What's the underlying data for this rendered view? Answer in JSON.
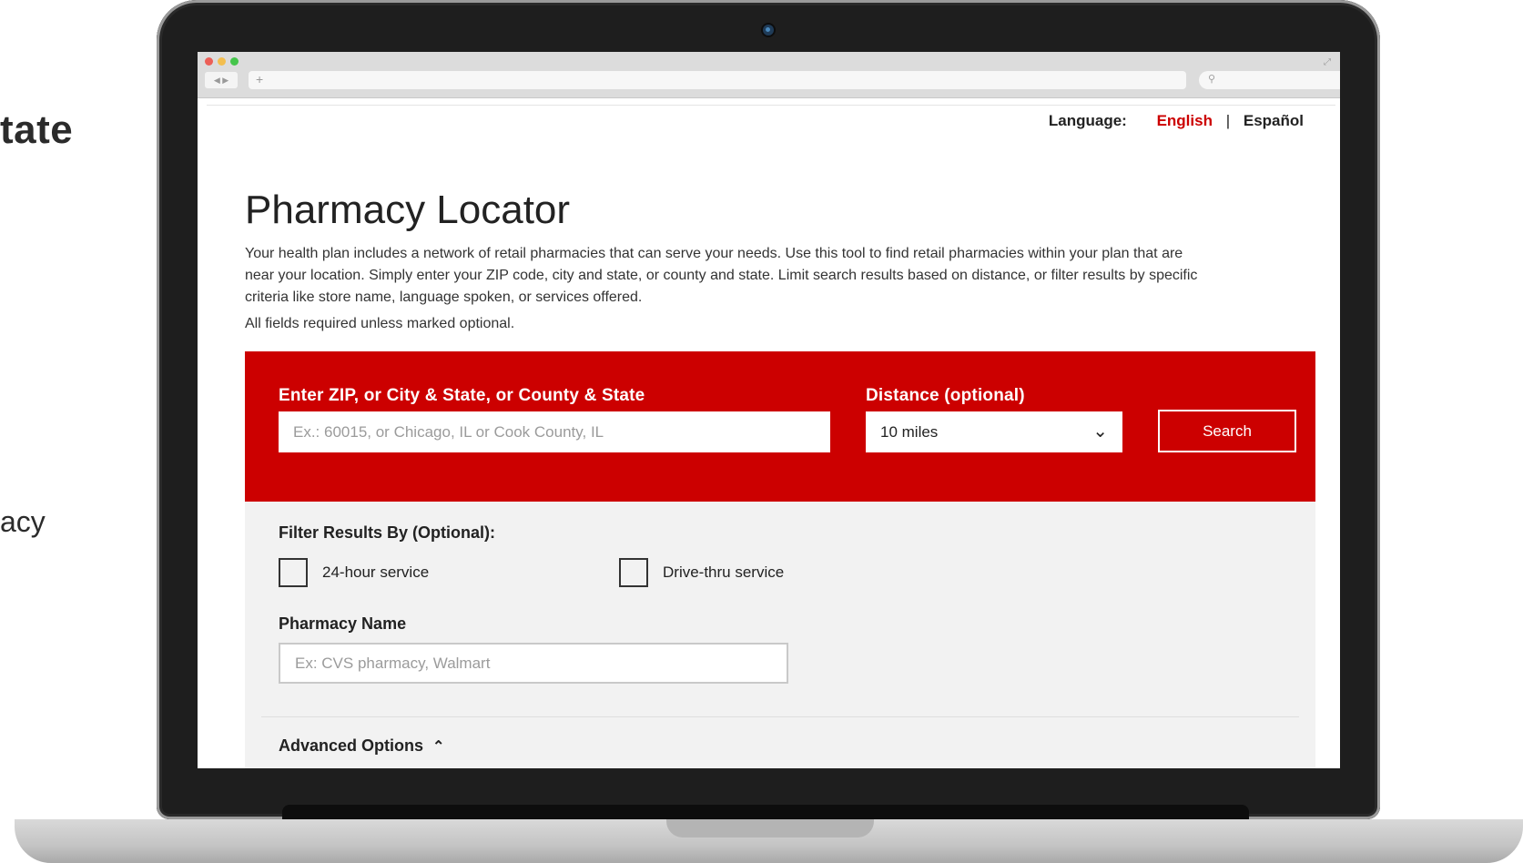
{
  "side": {
    "heading_fragment": "tate",
    "body_fragment": "acy"
  },
  "language": {
    "label": "Language:",
    "options": [
      "English",
      "Español"
    ],
    "active": "English",
    "separator": "|"
  },
  "page": {
    "title": "Pharmacy Locator",
    "intro": "Your health plan includes a network of retail pharmacies that can serve your needs. Use this tool to find retail pharmacies within your plan that are near your location. Simply enter your ZIP code, city and state, or county and state. Limit search results based on distance, or filter results by specific criteria like store name, language spoken, or services offered.",
    "required_note": "All fields required unless marked optional."
  },
  "search": {
    "location_label": "Enter ZIP, or City & State, or County & State",
    "location_placeholder": "Ex.: 60015, or Chicago, IL or Cook County, IL",
    "distance_label": "Distance (optional)",
    "distance_value": "10 miles",
    "button_label": "Search"
  },
  "filters": {
    "title": "Filter Results By (Optional):",
    "checkboxes": [
      {
        "label": "24-hour service",
        "checked": false
      },
      {
        "label": "Drive-thru service",
        "checked": false
      }
    ],
    "pharmacy_name_label": "Pharmacy Name",
    "pharmacy_name_placeholder": "Ex: CVS pharmacy, Walmart",
    "advanced_label": "Advanced Options"
  },
  "icons": {
    "dropdown": "chevron-down-icon",
    "advanced_toggle": "chevron-up-icon",
    "browser_search": "search-icon"
  },
  "colors": {
    "accent_red": "#cc0000",
    "filter_bg": "#f2f2f2",
    "text": "#222222"
  }
}
